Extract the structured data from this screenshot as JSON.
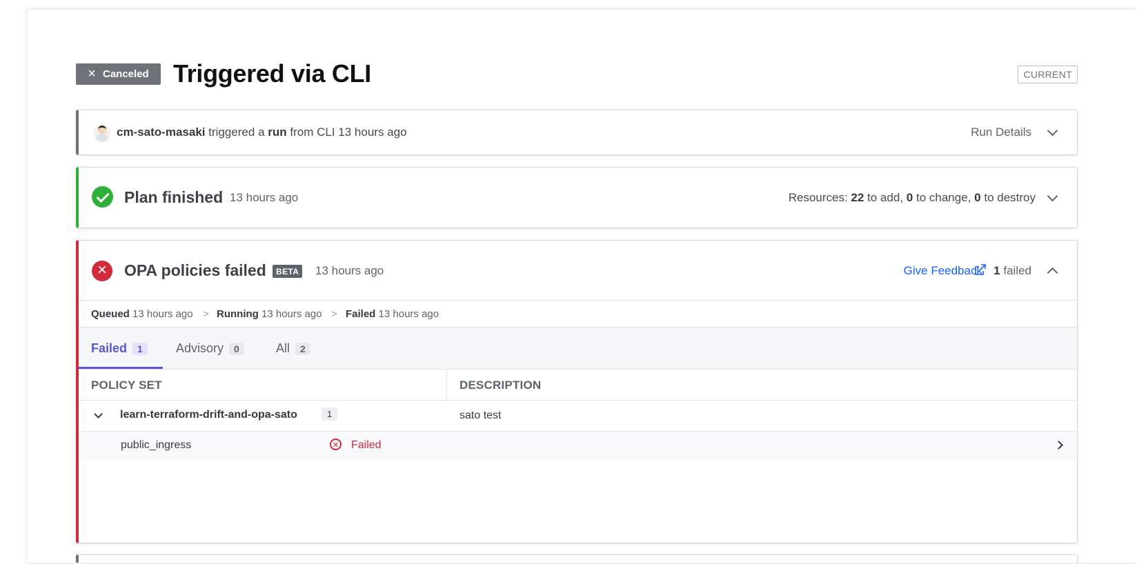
{
  "header": {
    "status": "Canceled",
    "title": "Triggered via CLI",
    "current_tag": "CURRENT"
  },
  "trigger": {
    "user": "cm-sato-masaki",
    "text_a": "triggered a",
    "run": "run",
    "text_b": "from CLI 13 hours ago",
    "run_details": "Run Details"
  },
  "plan": {
    "title": "Plan finished",
    "time": "13 hours ago",
    "resources_label": "Resources:",
    "add_count": "22",
    "add_text": "to add,",
    "change_count": "0",
    "change_text": "to change,",
    "destroy_count": "0",
    "destroy_text": "to destroy"
  },
  "opa": {
    "title": "OPA policies failed",
    "badge": "BETA",
    "time": "13 hours ago",
    "feedback": "Give Feedback",
    "failed_num": "1",
    "failed_text": "failed",
    "timeline": {
      "queued_label": "Queued",
      "queued_time": "13 hours ago",
      "running_label": "Running",
      "running_time": "13 hours ago",
      "failed_label": "Failed",
      "failed_time": "13 hours ago",
      "separator": ">"
    },
    "tabs": [
      {
        "label": "Failed",
        "count": "1"
      },
      {
        "label": "Advisory",
        "count": "0"
      },
      {
        "label": "All",
        "count": "2"
      }
    ],
    "columns": [
      "POLICY SET",
      "DESCRIPTION"
    ],
    "policy_set": {
      "name": "learn-terraform-drift-and-opa-sato",
      "count": "1",
      "description": "sato test"
    },
    "policy": {
      "name": "public_ingress",
      "status": "Failed"
    }
  },
  "colors": {
    "success": "#2eb039",
    "error": "#d02a3c",
    "accent": "#5b54d6",
    "link": "#1563ff"
  }
}
